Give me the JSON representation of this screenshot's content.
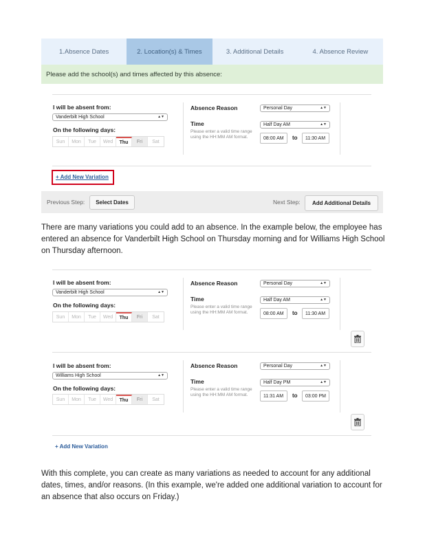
{
  "steps": [
    "1.Absence Dates",
    "2. Location(s) & Times",
    "3. Additional Details",
    "4. Absence Review"
  ],
  "banner": "Please add the school(s) and times affected by this absence:",
  "labels": {
    "absent_from": "I will be absent from:",
    "following_days": "On the following days:",
    "absence_reason": "Absence Reason",
    "time": "Time",
    "time_help": "Please enter a valid time range using the HH:MM AM format.",
    "to": "to"
  },
  "days": [
    "Sun",
    "Mon",
    "Tue",
    "Wed",
    "Thu",
    "Fri",
    "Sat"
  ],
  "variation_top": {
    "school": "Vanderbilt High School",
    "reason": "Personal Day",
    "time": "Half Day AM",
    "start": "08:00 AM",
    "end": "11:30 AM",
    "selected_day": "Thu"
  },
  "add_new_variation": "+ Add New Variation",
  "nav": {
    "previous_step_label": "Previous Step:",
    "previous_button": "Select Dates",
    "next_step_label": "Next Step:",
    "next_button": "Add Additional Details"
  },
  "paragraph1": "There are many variations you could add to an absence. In the example below, the employee has entered an absence for Vanderbilt High School on Thursday morning and for Williams High School on Thursday afternoon.",
  "variation_example_1": {
    "school": "Vanderbilt High School",
    "reason": "Personal Day",
    "time": "Half Day AM",
    "start": "08:00 AM",
    "end": "11:30 AM",
    "selected_day": "Thu"
  },
  "variation_example_2": {
    "school": "Williams High School",
    "reason": "Personal Day",
    "time": "Half Day PM",
    "start": "11:31 AM",
    "end": "03:00 PM",
    "selected_day": "Thu"
  },
  "paragraph2": "With this complete, you can create as many variations as needed to account for any additional dates, times, and/or reasons. (In this example, we're added one additional variation to account for an absence that also occurs on Friday.)",
  "colors": {
    "tab_bg": "#e8f1fb",
    "tab_active": "#a9c8e6",
    "banner_bg": "#dff0d8",
    "highlight": "#d0021b",
    "link": "#2a5b9a"
  },
  "icons": {
    "trash": "trash-icon",
    "dropdown": "chevron-updown-icon"
  }
}
